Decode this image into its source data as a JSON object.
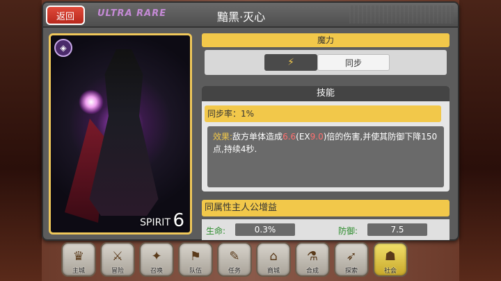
{
  "header": {
    "back_label": "返回",
    "rarity": "ULTRA RARE",
    "title": "黯黑·灭心"
  },
  "card": {
    "spirit_label": "SPIRIT",
    "spirit_value": "6"
  },
  "mana": {
    "title": "魔力",
    "sync_label": "同步"
  },
  "skill": {
    "title": "技能",
    "sync_rate": "同步率：1%",
    "effect_label": "效果:",
    "effect_pre": "敌方单体造成",
    "effect_v1": "6.6",
    "effect_mid1": "(EX",
    "effect_v2": "9.0",
    "effect_post": ")倍的伤害,并使其防御下降150点,持续4秒."
  },
  "bonus": {
    "title": "同属性主人公增益",
    "hp_label": "生命:",
    "hp_value": "0.3%",
    "def_label": "防御:",
    "def_value": "7.5"
  },
  "nav": [
    {
      "label": "主城",
      "icon": "♛"
    },
    {
      "label": "冒险",
      "icon": "⚔"
    },
    {
      "label": "召唤",
      "icon": "✦"
    },
    {
      "label": "队伍",
      "icon": "⚑"
    },
    {
      "label": "任务",
      "icon": "✎"
    },
    {
      "label": "商城",
      "icon": "⌂"
    },
    {
      "label": "合成",
      "icon": "⚗"
    },
    {
      "label": "探索",
      "icon": "➶"
    },
    {
      "label": "社会",
      "icon": "☗"
    }
  ]
}
